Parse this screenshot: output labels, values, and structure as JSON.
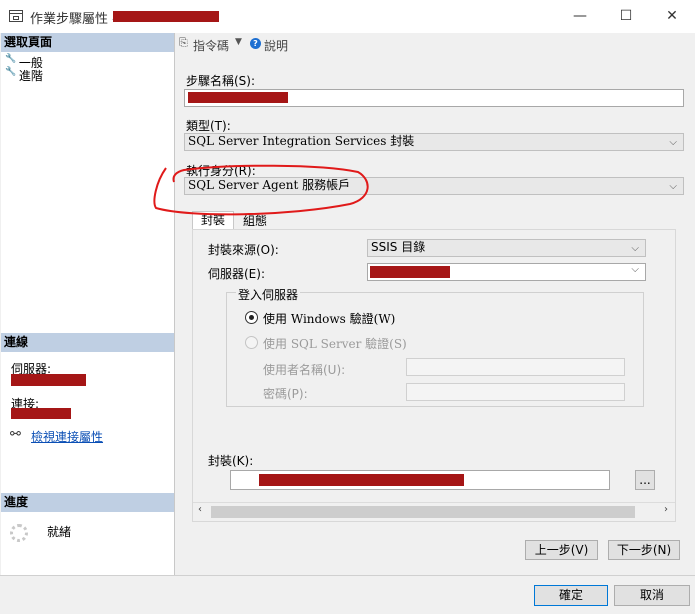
{
  "window": {
    "title": "作業步驟屬性 - ",
    "minimize": "—",
    "maximize": "☐",
    "close": "✕"
  },
  "left": {
    "select_page_header": "選取頁面",
    "pages": [
      "一般",
      "進階"
    ],
    "connection_header": "連線",
    "server_label": "伺服器:",
    "connection_label": "連接:",
    "view_connection_link": "檢視連接屬性",
    "progress_header": "進度",
    "progress_status": "就緒"
  },
  "toolbar": {
    "script_label": "指令碼",
    "help_label": "說明"
  },
  "form": {
    "step_name_label": "步驟名稱(S):",
    "type_label": "類型(T):",
    "type_value": "SQL Server Integration Services 封裝",
    "run_as_label": "執行身分(R):",
    "run_as_value": "SQL Server Agent 服務帳戶",
    "tabs": [
      "封裝",
      "組態"
    ],
    "package_source_label": "封裝來源(O):",
    "package_source_value": "SSIS 目錄",
    "server_label": "伺服器(E):",
    "login_group_label": "登入伺服器",
    "windows_auth_label": "使用 Windows 驗證(W)",
    "sql_auth_label": "使用 SQL Server 驗證(S)",
    "username_label": "使用者名稱(U):",
    "password_label": "密碼(P):",
    "package_label": "封裝(K):",
    "browse_label": "..."
  },
  "nav": {
    "prev_label": "上一步(V)",
    "next_label": "下一步(N)"
  },
  "footer": {
    "ok_label": "確定",
    "cancel_label": "取消"
  },
  "colors": {
    "annotation_red": "#e01a1a",
    "redaction": "#a51616",
    "section_header": "#bfcfe3",
    "link": "#0b4fb5",
    "ok_border": "#0078d7"
  }
}
